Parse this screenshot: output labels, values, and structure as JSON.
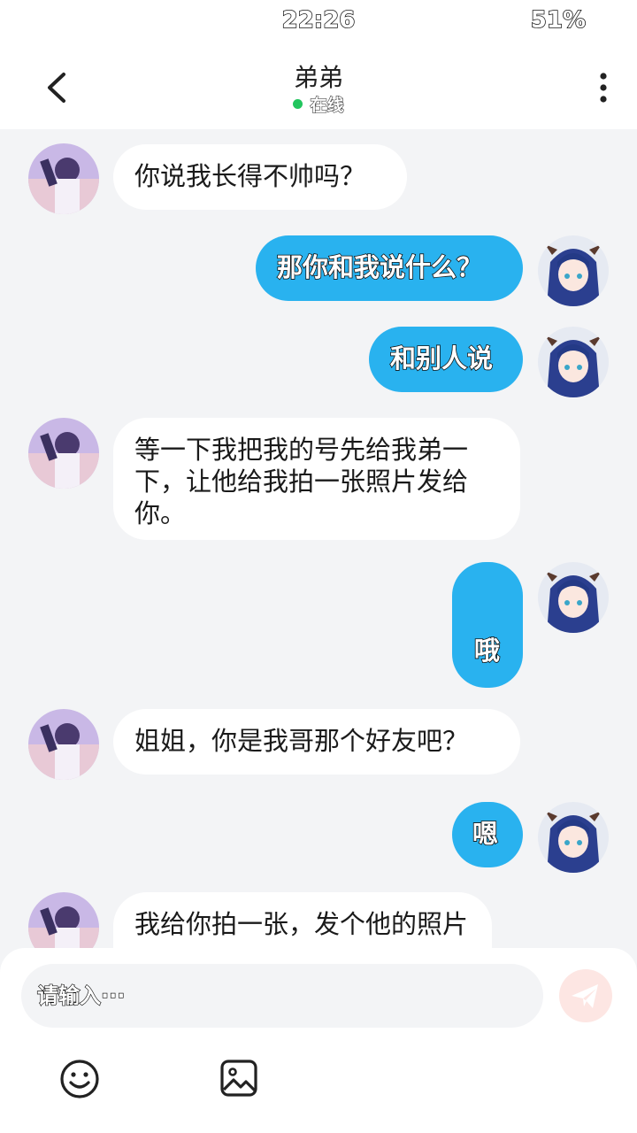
{
  "status_bar": {
    "time": "22:26",
    "battery": "51%"
  },
  "header": {
    "title": "弟弟",
    "status": "在线",
    "status_color": "#22c55e"
  },
  "messages": [
    {
      "side": "in",
      "text": "你说我长得不帅吗？"
    },
    {
      "side": "out",
      "text": "那你和我说什么？"
    },
    {
      "side": "out",
      "text": "和别人说"
    },
    {
      "side": "in",
      "text": "等一下我把我的号先给我弟一下，让他给我拍一张照片发给你。"
    },
    {
      "side": "out",
      "text": "哦"
    },
    {
      "side": "in",
      "text": "姐姐，你是我哥那个好友吧？"
    },
    {
      "side": "out",
      "text": "嗯"
    },
    {
      "side": "in",
      "text": "我给你拍一张，发个他的照片"
    }
  ],
  "composer": {
    "placeholder": "请输入···",
    "send_icon": "send-icon",
    "emoji_icon": "smiley-icon",
    "image_icon": "image-icon"
  },
  "colors": {
    "outgoing_bubble": "#29b2ef",
    "incoming_bubble": "#ffffff",
    "background": "#f3f4f6"
  }
}
